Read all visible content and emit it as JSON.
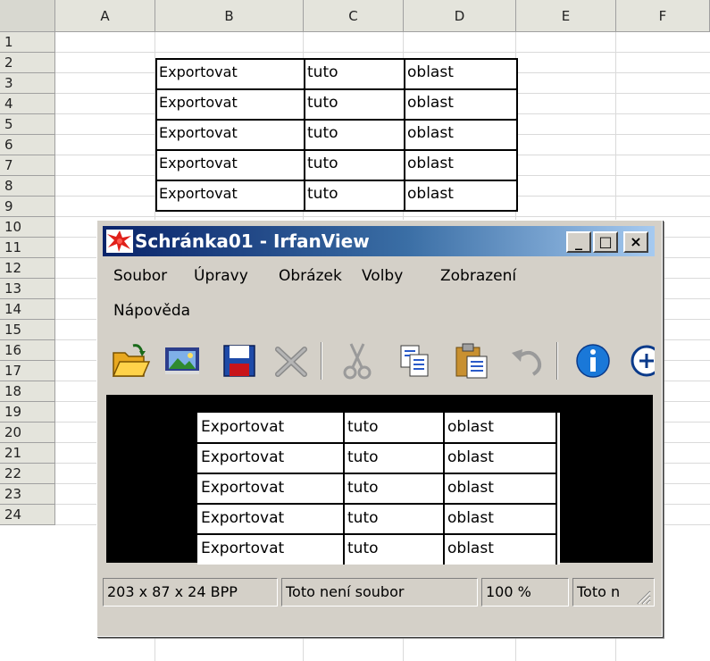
{
  "spreadsheet": {
    "columns": [
      "A",
      "B",
      "C",
      "D",
      "E",
      "F"
    ],
    "rows": [
      "1",
      "2",
      "3",
      "4",
      "5",
      "6",
      "7",
      "8",
      "9",
      "10",
      "11",
      "12",
      "13",
      "14",
      "15",
      "16",
      "17",
      "18",
      "19",
      "20",
      "21",
      "22",
      "23",
      "24"
    ],
    "table": [
      [
        "Exportovat",
        "tuto",
        "oblast"
      ],
      [
        "Exportovat",
        "tuto",
        "oblast"
      ],
      [
        "Exportovat",
        "tuto",
        "oblast"
      ],
      [
        "Exportovat",
        "tuto",
        "oblast"
      ],
      [
        "Exportovat",
        "tuto",
        "oblast"
      ]
    ]
  },
  "window": {
    "title": "Schránka01 - IrfanView",
    "buttons": {
      "minimize": "_",
      "maximize": "□",
      "close": "×"
    },
    "menu": [
      "Soubor",
      "Úpravy",
      "Obrázek",
      "Volby",
      "Zobrazení",
      "Nápověda"
    ],
    "toolbar_icons": [
      "open-folder-icon",
      "thumbnails-icon",
      "save-icon",
      "delete-icon",
      "cut-icon",
      "copy-icon",
      "paste-icon",
      "undo-icon",
      "info-icon",
      "zoom-in-icon"
    ],
    "image_table": [
      [
        "Exportovat",
        "tuto",
        "oblast"
      ],
      [
        "Exportovat",
        "tuto",
        "oblast"
      ],
      [
        "Exportovat",
        "tuto",
        "oblast"
      ],
      [
        "Exportovat",
        "tuto",
        "oblast"
      ],
      [
        "Exportovat",
        "tuto",
        "oblast"
      ]
    ],
    "status": {
      "dimensions": "203 x 87 x 24 BPP",
      "file": "Toto není soubor",
      "zoom": "100 %",
      "extra": "Toto n"
    }
  },
  "colors": {
    "title_gradient_start": "#0a246a",
    "title_gradient_end": "#a6caf0",
    "window_face": "#d4d0c8",
    "header_bg": "#e4e4dc"
  }
}
